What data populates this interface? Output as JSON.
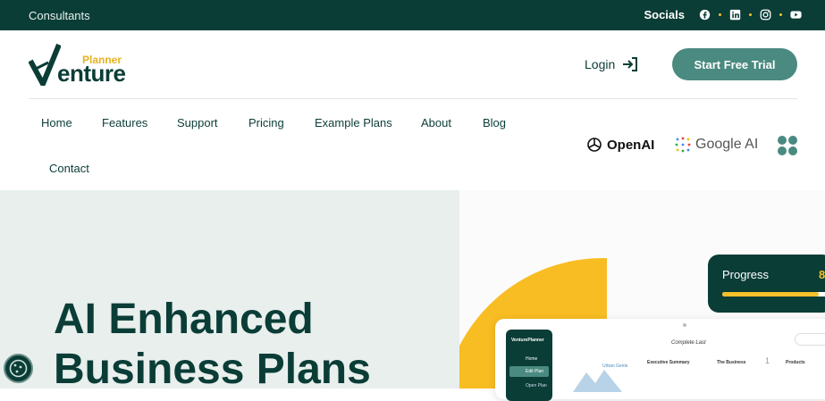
{
  "topbar": {
    "left_text": "Consultants",
    "socials_label": "Socials",
    "socials": [
      "facebook-icon",
      "linkedin-icon",
      "instagram-icon",
      "youtube-icon"
    ]
  },
  "brand": {
    "planner": "Planner",
    "venture": "enture"
  },
  "header": {
    "login": "Login",
    "cta": "Start Free Trial"
  },
  "nav": [
    "Home",
    "Features",
    "Support",
    "Pricing",
    "Example Plans",
    "About",
    "Blog",
    "Contact"
  ],
  "partners": {
    "openai": "OpenAI",
    "google": "Google AI"
  },
  "hero": {
    "title_line1": "AI Enhanced",
    "title_line2": "Business Plans"
  },
  "progress": {
    "label": "Progress",
    "value_visible": "8",
    "fill_fraction": 0.9
  },
  "app_preview": {
    "brand": "VenturePlanner",
    "menu": [
      "Home",
      "Edit Plan",
      "Open Plan"
    ],
    "annotation": "Complete Last",
    "columns": [
      "Urban Gents",
      "Executive Summary",
      "The Business",
      "Products"
    ],
    "business_count": "1"
  },
  "colors": {
    "brand": "#0b3d37",
    "accent": "#f5c02a",
    "cta": "#4a8a80"
  }
}
